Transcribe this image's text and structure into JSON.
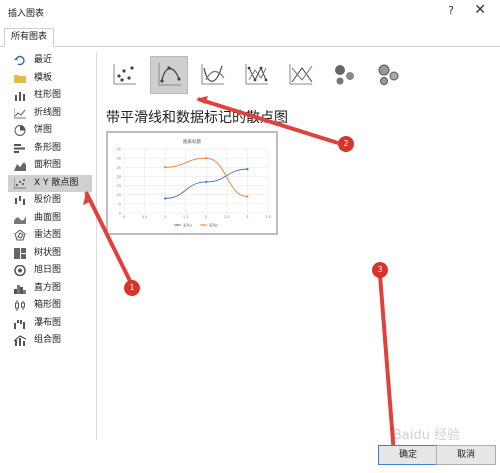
{
  "window": {
    "title": "插入图表",
    "help": "?",
    "close": "✕"
  },
  "tabs": [
    {
      "label": "所有图表"
    }
  ],
  "sidebar": {
    "items": [
      {
        "label": "最近",
        "icon": "recent-icon"
      },
      {
        "label": "模板",
        "icon": "folder-icon"
      },
      {
        "label": "柱形图",
        "icon": "column-chart-icon"
      },
      {
        "label": "折线图",
        "icon": "line-chart-icon"
      },
      {
        "label": "饼图",
        "icon": "pie-chart-icon"
      },
      {
        "label": "条形图",
        "icon": "bar-chart-icon"
      },
      {
        "label": "面积图",
        "icon": "area-chart-icon"
      },
      {
        "label": "X Y 散点图",
        "icon": "scatter-chart-icon"
      },
      {
        "label": "股价图",
        "icon": "stock-chart-icon"
      },
      {
        "label": "曲面图",
        "icon": "surface-chart-icon"
      },
      {
        "label": "雷达图",
        "icon": "radar-chart-icon"
      },
      {
        "label": "树状图",
        "icon": "treemap-icon"
      },
      {
        "label": "旭日图",
        "icon": "sunburst-icon"
      },
      {
        "label": "直方图",
        "icon": "histogram-icon"
      },
      {
        "label": "箱形图",
        "icon": "box-whisker-icon"
      },
      {
        "label": "瀑布图",
        "icon": "waterfall-icon"
      },
      {
        "label": "组合图",
        "icon": "combo-chart-icon"
      }
    ],
    "selected": 7
  },
  "subtypes": [
    {
      "icon": "scatter-markers-icon"
    },
    {
      "icon": "scatter-smooth-markers-icon"
    },
    {
      "icon": "scatter-smooth-icon"
    },
    {
      "icon": "scatter-straight-markers-icon"
    },
    {
      "icon": "scatter-straight-icon"
    },
    {
      "icon": "bubble-icon"
    },
    {
      "icon": "bubble-3d-icon"
    }
  ],
  "selected_subtype": 1,
  "subtype_title": "带平滑线和数据标记的散点图",
  "preview": {
    "chart_data": {
      "type": "scatter",
      "title": "图表标题",
      "y_ticks": [
        "35",
        "30",
        "25",
        "20",
        "15",
        "10",
        "5",
        "0"
      ],
      "x_ticks": [
        "0",
        "0.5",
        "1",
        "1.5",
        "2",
        "2.5",
        "3",
        "3.5"
      ],
      "xlim": [
        0,
        3.5
      ],
      "ylim": [
        0,
        35
      ],
      "series": [
        {
          "name": "系列1",
          "color": "#4472c4",
          "x": [
            1,
            2,
            3
          ],
          "y": [
            8,
            17,
            24
          ]
        },
        {
          "name": "系列2",
          "color": "#ed7d31",
          "x": [
            1,
            2,
            3
          ],
          "y": [
            25,
            30,
            9
          ]
        }
      ],
      "legend": "bottom",
      "grid": true
    }
  },
  "annotations": [
    "1",
    "2",
    "3"
  ],
  "buttons": {
    "ok": "确定",
    "cancel": "取消"
  },
  "watermark": "Baidu 经验"
}
